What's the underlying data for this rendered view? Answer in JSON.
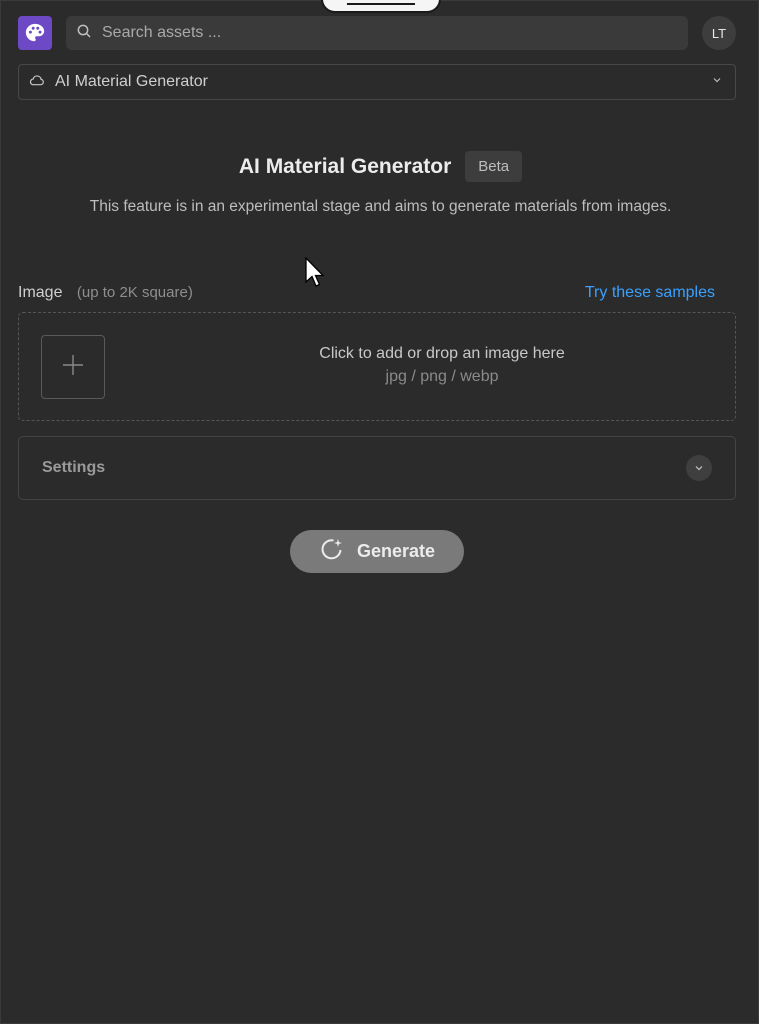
{
  "header": {
    "logo_icon": "palette-icon",
    "search_placeholder": "Search assets ...",
    "avatar_initials": "LT"
  },
  "tool_select": {
    "icon": "cloud-icon",
    "selected": "AI Material Generator"
  },
  "hero": {
    "title": "AI Material Generator",
    "badge": "Beta",
    "description": "This feature is in an experimental stage and aims to generate materials from images."
  },
  "image_input": {
    "label": "Image",
    "sublabel": "(up to 2K square)",
    "samples_link": "Try these samples",
    "drop_text": "Click to add or drop an image here",
    "formats": "jpg / png / webp"
  },
  "settings": {
    "label": "Settings"
  },
  "generate": {
    "label": "Generate"
  },
  "colors": {
    "background": "#2b2b2b",
    "brand": "#6e49c6",
    "link": "#3aa0ff",
    "generate_button": "#7a7a7a"
  }
}
